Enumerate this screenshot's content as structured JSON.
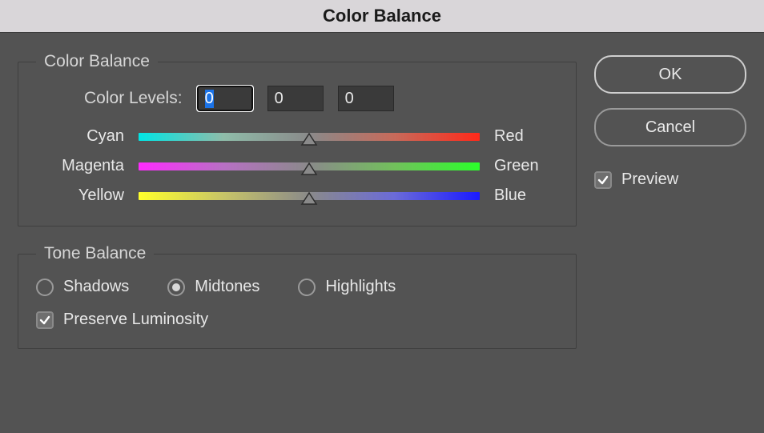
{
  "window": {
    "title": "Color Balance"
  },
  "color_balance": {
    "legend": "Color Balance",
    "levels_label": "Color Levels:",
    "levels": {
      "a": "0",
      "b": "0",
      "c": "0"
    },
    "sliders": {
      "cyan_red": {
        "left": "Cyan",
        "right": "Red"
      },
      "mag_green": {
        "left": "Magenta",
        "right": "Green"
      },
      "yel_blue": {
        "left": "Yellow",
        "right": "Blue"
      }
    }
  },
  "tone_balance": {
    "legend": "Tone Balance",
    "shadows": "Shadows",
    "midtones": "Midtones",
    "highlights": "Highlights",
    "preserve": "Preserve Luminosity"
  },
  "buttons": {
    "ok": "OK",
    "cancel": "Cancel"
  },
  "preview_label": "Preview"
}
